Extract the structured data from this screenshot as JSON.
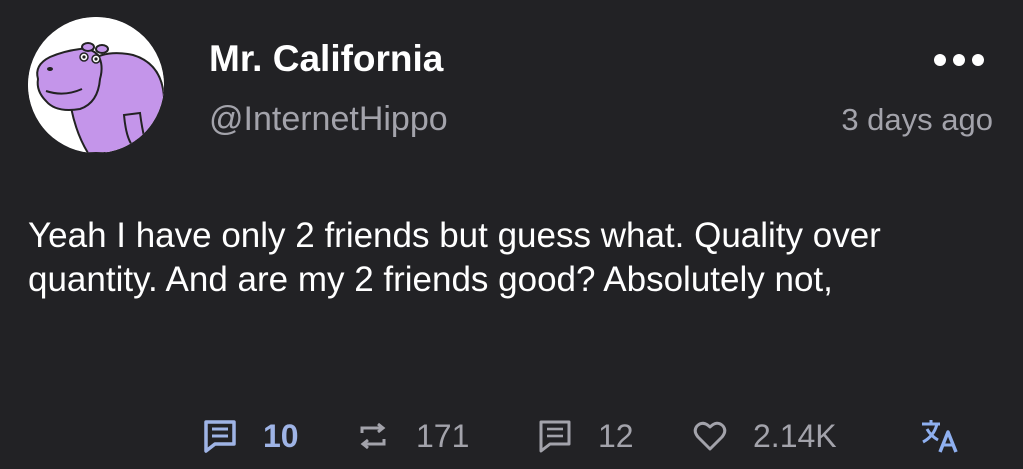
{
  "post": {
    "author": {
      "display_name": "Mr. California",
      "handle": "@InternetHippo",
      "avatar_icon": "hippo-avatar-icon"
    },
    "timestamp": "3 days ago",
    "text": "Yeah I have only 2 friends but guess what. Quality over quantity. And are my 2 friends good? Absolutely not,",
    "actions": {
      "replies": {
        "icon": "reply-icon",
        "count": "10"
      },
      "boosts": {
        "icon": "boost-icon",
        "count": "171"
      },
      "quotes": {
        "icon": "quote-icon",
        "count": "12"
      },
      "likes": {
        "icon": "heart-icon",
        "count": "2.14K"
      },
      "translate": {
        "icon": "translate-icon"
      }
    }
  },
  "colors": {
    "background": "#222225",
    "primary_text": "#ffffff",
    "secondary_text": "#a3a3ab",
    "accent": "#9fb4e6",
    "avatar_purple": "#c495ea"
  }
}
